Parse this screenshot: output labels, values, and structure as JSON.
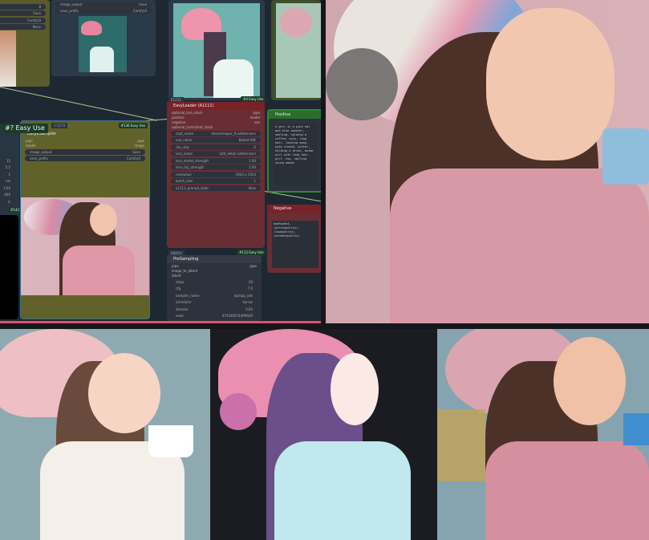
{
  "graph": {
    "top_left_rows": [
      {
        "label": "",
        "value": "8"
      },
      {
        "label": "",
        "value": "Save"
      },
      {
        "label": "",
        "value": "ComfyUI"
      },
      {
        "label": "",
        "value": "None"
      }
    ],
    "top_preview": {
      "rows": [
        {
          "label": "image_output",
          "value": "Save"
        },
        {
          "label": "save_prefix",
          "value": "ComfyUI"
        }
      ]
    },
    "left_node_badge": "#? Easy Use",
    "left_rows": [
      "15",
      "5.5",
      "1",
      "ras",
      "1.00",
      "000",
      "ls"
    ],
    "left_badge2": "#142",
    "kSampler": {
      "id": "1:1173",
      "badge": "#136 Easy Use",
      "title": "EasyKSampler",
      "inputs": [
        "pipe",
        "model"
      ],
      "outputs": [
        "pipe",
        "image"
      ],
      "rows": [
        {
          "label": "image_output",
          "value": "Save"
        },
        {
          "label": "save_prefix",
          "value": "ComfyUI"
        }
      ]
    },
    "loader": {
      "id": "E1Z15",
      "badge": "#4 Easy Use",
      "title": "EasyLoader (A1111)",
      "inputs": [
        "optional_lora_stack",
        "positive",
        "negative",
        "optional_controlnet_stack"
      ],
      "outputs": [
        "pipe",
        "model",
        "vae"
      ],
      "rows": [
        {
          "label": "ckpt_name",
          "value": "dreamshaper_8.safetensors"
        },
        {
          "label": "vae_name",
          "value": "Baked VAE"
        },
        {
          "label": "clip_skip",
          "value": "-2"
        },
        {
          "label": "lora_name",
          "value": "add_detail.safetensors"
        },
        {
          "label": "lora_model_strength",
          "value": "1.00"
        },
        {
          "label": "lora_clip_strength",
          "value": "1.00"
        },
        {
          "label": "resolution",
          "value": "1024 x 1024"
        },
        {
          "label": "batch_size",
          "value": "1"
        },
        {
          "label": "a1111_prompt_style",
          "value": "false"
        }
      ]
    },
    "positive": {
      "title": "Positive",
      "text": "a girl in a pink hat and blue sweater, smiling, holding a coffee, solo, long hair, looking away, eyes closed, winter, holding a drink, anime girl with long hair, girl, cup, smiling young woman"
    },
    "negative": {
      "title": "Negative",
      "text": "badhandv4, (worstquality), (lowquality), (normalquality)"
    },
    "presampling": {
      "id": "E84OU",
      "badge": "#112 Easy Use",
      "title": "PreSampling",
      "inputs": [
        "pipe",
        "image_to_latent",
        "latent"
      ],
      "outputs": [
        "pipe"
      ],
      "rows": [
        {
          "label": "steps",
          "value": "20"
        },
        {
          "label": "cfg",
          "value": "7.0"
        },
        {
          "label": "sampler_name",
          "value": "dpmpp_sde"
        },
        {
          "label": "scheduler",
          "value": "karras"
        },
        {
          "label": "denoise",
          "value": "0.60"
        },
        {
          "label": "seed",
          "value": "474248574499640"
        }
      ]
    }
  },
  "images": [
    {
      "name": "girl-pink-blue-beanie-photo"
    },
    {
      "name": "girl-white-sweater-illustration"
    },
    {
      "name": "girl-anime-dark-background"
    },
    {
      "name": "girl-pink-sweater-photo"
    }
  ]
}
